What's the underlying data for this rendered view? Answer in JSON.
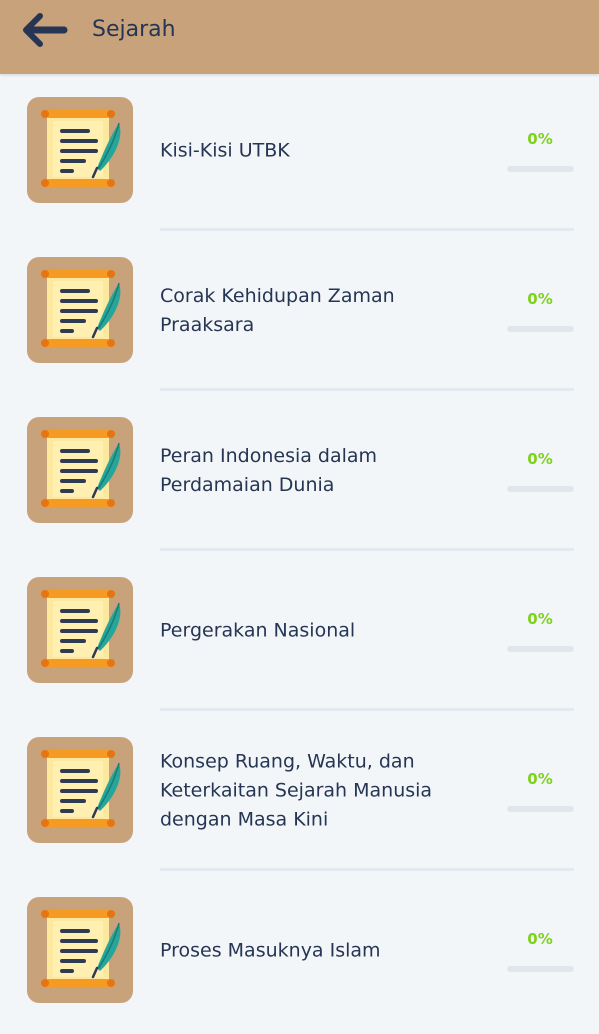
{
  "header": {
    "title": "Sejarah",
    "back_icon": "arrow-left-icon",
    "background": "#c7a27b"
  },
  "topics": [
    {
      "title": "Kisi-Kisi UTBK",
      "progress_label": "0%",
      "progress": 0,
      "icon": "scroll-quill-icon"
    },
    {
      "title": "Corak Kehidupan Zaman Praaksara",
      "progress_label": "0%",
      "progress": 0,
      "icon": "scroll-quill-icon"
    },
    {
      "title": "Peran Indonesia dalam Perdamaian Dunia",
      "progress_label": "0%",
      "progress": 0,
      "icon": "scroll-quill-icon"
    },
    {
      "title": "Pergerakan Nasional",
      "progress_label": "0%",
      "progress": 0,
      "icon": "scroll-quill-icon"
    },
    {
      "title": "Konsep Ruang, Waktu, dan Keterkaitan Sejarah Manusia dengan Masa Kini",
      "progress_label": "0%",
      "progress": 0,
      "icon": "scroll-quill-icon"
    },
    {
      "title": "Proses Masuknya Islam",
      "progress_label": "0%",
      "progress": 0,
      "icon": "scroll-quill-icon"
    }
  ],
  "colors": {
    "accent": "#7ed321",
    "text": "#253553",
    "thumb_bg": "#c7a27b"
  }
}
